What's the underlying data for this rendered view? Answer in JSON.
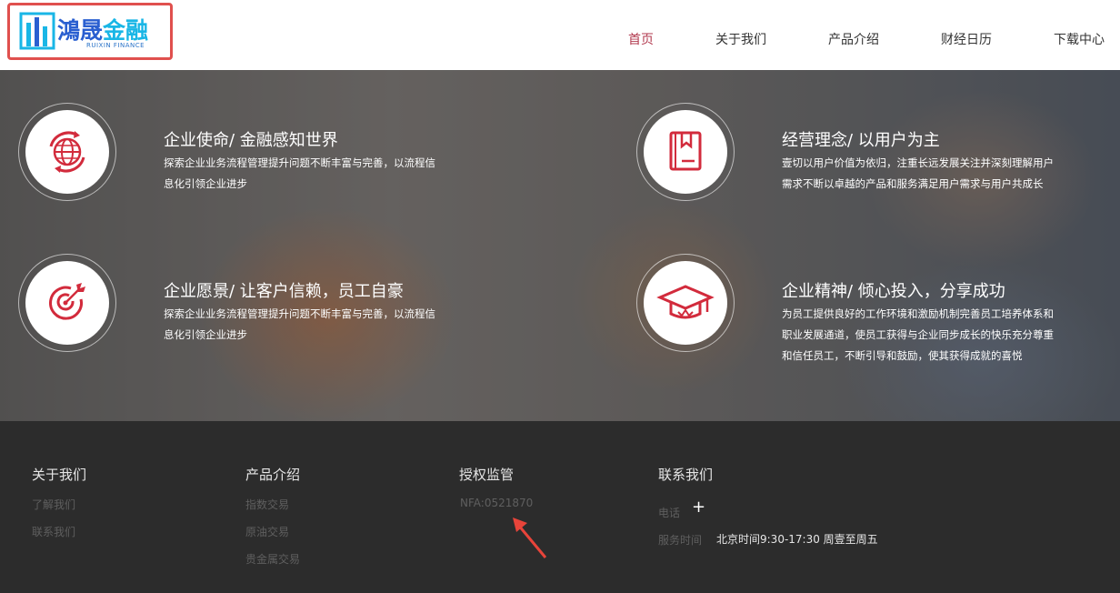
{
  "logo": {
    "text_part1": "鴻晟",
    "text_part2": "金融",
    "subtitle": "RUIXIN FINANCE"
  },
  "nav": {
    "items": [
      {
        "label": "首页",
        "active": true
      },
      {
        "label": "关于我们",
        "active": false
      },
      {
        "label": "产品介绍",
        "active": false
      },
      {
        "label": "财经日历",
        "active": false
      },
      {
        "label": "下载中心",
        "active": false
      }
    ]
  },
  "features": [
    {
      "title": "企业使命/ 金融感知世界",
      "desc_lines": [
        "探索企业业务流程管理提升问题不断丰富与完善，以流程信",
        "息化引领企业进步"
      ],
      "icon": "globe-icon"
    },
    {
      "title": "经营理念/ 以用户为主",
      "desc_lines": [
        "壹切以用户价值为依归，注重长远发展关注并深刻理解用户",
        "需求不断以卓越的产品和服务满足用户需求与用户共成长"
      ],
      "icon": "book-icon"
    },
    {
      "title": "企业愿景/ 让客户信赖，员工自豪",
      "desc_lines": [
        "探索企业业务流程管理提升问题不断丰富与完善，以流程信",
        "息化引领企业进步"
      ],
      "icon": "target-icon"
    },
    {
      "title": "企业精神/ 倾心投入，分享成功",
      "desc_lines": [
        "为员工提供良好的工作环境和激励机制完善员工培养体系和",
        "职业发展通道，使员工获得与企业同步成长的快乐充分尊重",
        "和信任员工，不断引导和鼓励，使其获得成就的喜悦"
      ],
      "icon": "graduation-cap-icon"
    }
  ],
  "footer": {
    "about": {
      "heading": "关于我们",
      "links": [
        "了解我们",
        "联系我们"
      ]
    },
    "products": {
      "heading": "产品介绍",
      "links": [
        "指数交易",
        "原油交易",
        "贵金属交易"
      ]
    },
    "license": {
      "heading": "授权监管",
      "nfa": "NFA:0521870"
    },
    "contact": {
      "heading": "联系我们",
      "phone_label": "电话",
      "phone_value": "+",
      "hours_label": "服务时间",
      "hours_value": "北京时间9:30-17:30 周壹至周五"
    }
  },
  "colors": {
    "accent": "#b23a4f",
    "icon_red": "#d22b3c",
    "highlight_box": "#e0504e",
    "annotation_arrow": "#e8443a"
  }
}
